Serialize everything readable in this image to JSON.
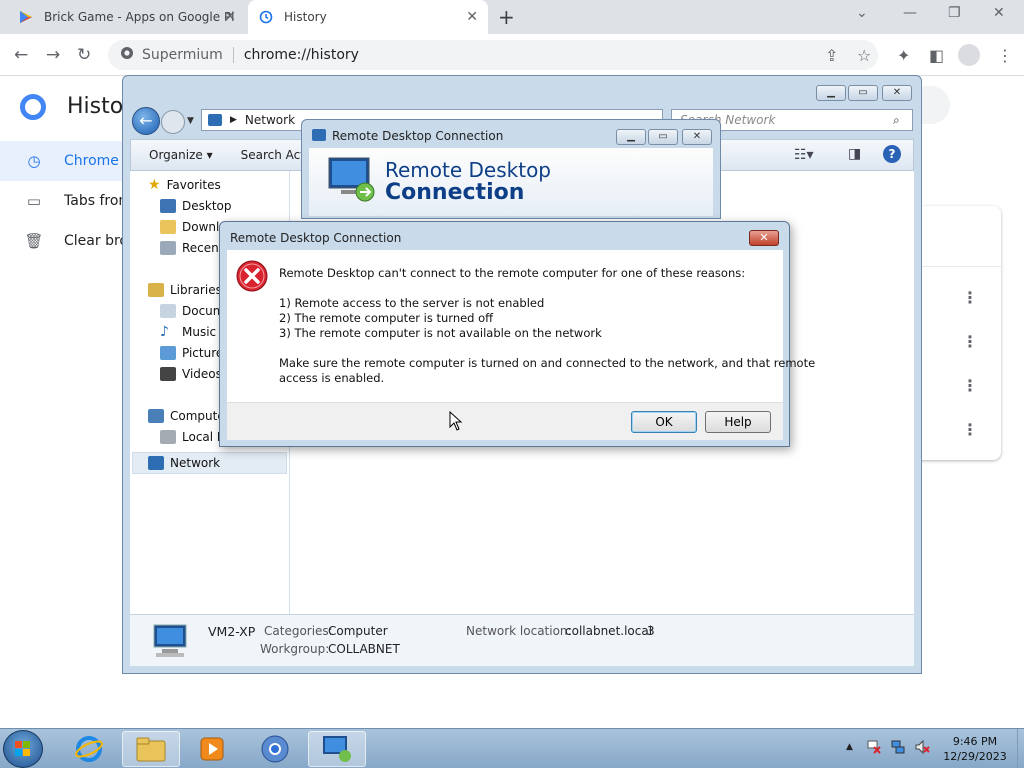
{
  "browser": {
    "tabs": [
      {
        "title": "Brick Game - Apps on Google Pl",
        "active": false
      },
      {
        "title": "History",
        "active": true
      }
    ],
    "omnibox": {
      "site": "Supermium",
      "url": "chrome://history"
    }
  },
  "history_page": {
    "title": "Histo",
    "nav": [
      {
        "label": "Chrome h",
        "active": true
      },
      {
        "label": "Tabs from"
      },
      {
        "label": "Clear bro"
      }
    ]
  },
  "explorer": {
    "address": "Network",
    "search_placeholder": "Search Network",
    "commands": [
      "Organize ▾",
      "Search Acti"
    ],
    "nav": {
      "favorites_header": "Favorites",
      "favorites": [
        "Desktop",
        "Downlo",
        "Recent"
      ],
      "libraries_header": "Libraries",
      "libraries": [
        "Docum",
        "Music",
        "Picture",
        "Videos"
      ],
      "computer_header": "Compute",
      "computer": [
        "Local D"
      ],
      "network": "Network"
    },
    "status": {
      "name": "VM2-XP",
      "categories_label": "Categories:",
      "categories_value": "Computer",
      "workgroup_label": "Workgroup:",
      "workgroup_value": "COLLABNET",
      "location_label": "Network location:",
      "location_value": "collabnet.local",
      "location_count": "3"
    }
  },
  "rdc_window": {
    "title": "Remote Desktop Connection",
    "banner_line1": "Remote Desktop",
    "banner_line2": "Connection"
  },
  "error_dialog": {
    "title": "Remote Desktop Connection",
    "message": "Remote Desktop can't connect to the remote computer for one of these reasons:",
    "reasons": [
      "1) Remote access to the server is not enabled",
      "2) The remote computer is turned off",
      "3) The remote computer is not available on the network"
    ],
    "advice_line1": "Make sure the remote computer is turned on and connected to the network, and that remote",
    "advice_line2": "access is enabled.",
    "ok": "OK",
    "help": "Help"
  },
  "taskbar": {
    "time": "9:46 PM",
    "date": "12/29/2023"
  },
  "colors": {
    "accent": "#1a73e8",
    "error": "#d9232e",
    "win_title": "#c9daea"
  }
}
